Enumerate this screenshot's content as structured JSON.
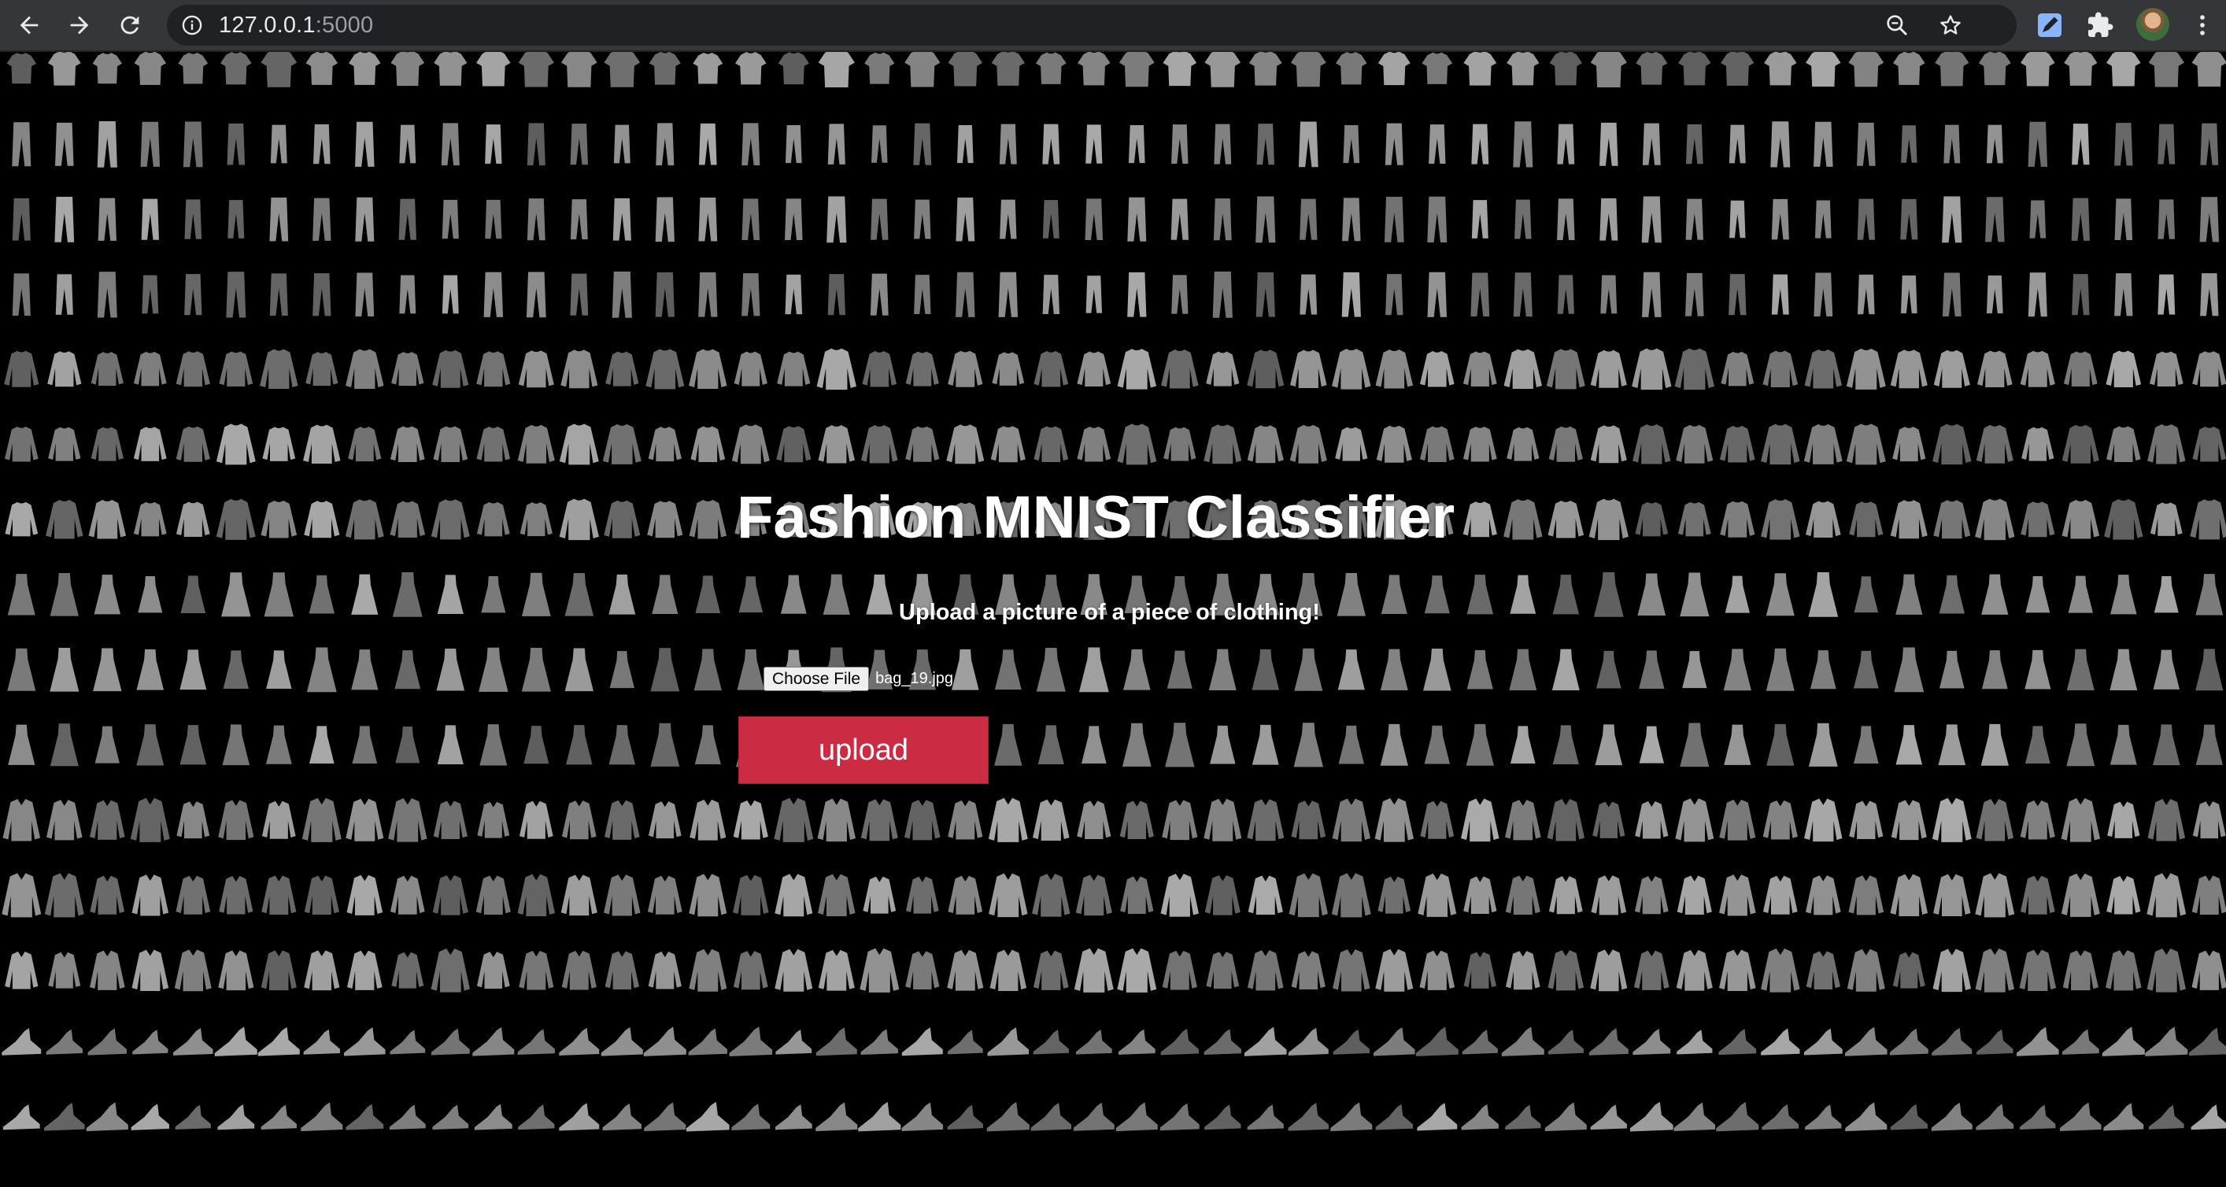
{
  "browser": {
    "url_host": "127.0.0.1",
    "url_port": ":5000",
    "nav": {
      "back_icon": "arrow-left-icon",
      "forward_icon": "arrow-right-icon",
      "reload_icon": "reload-icon"
    },
    "omnibox_icons": [
      "info-icon",
      "zoom-icon",
      "star-icon"
    ],
    "toolbar_icons": [
      "extension-pen-icon",
      "puzzle-icon",
      "avatar",
      "kebab-menu-icon"
    ]
  },
  "page": {
    "title": "Fashion MNIST Classifier",
    "subtitle": "Upload a picture of a piece of clothing!",
    "file_input": {
      "button_label": "Choose File",
      "file_name": "bag_19.jpg"
    },
    "upload_button": "upload",
    "colors": {
      "upload_button": "#cc2c43",
      "background": "#000000",
      "chrome": "#35363a",
      "omnibox": "#202124"
    },
    "background_image": "fashion-mnist-sample-grid",
    "background_row_kinds": [
      "top",
      "trouser",
      "trouser",
      "trouser",
      "pullover",
      "pullover",
      "pullover",
      "dress",
      "dress",
      "dress",
      "coat",
      "coat",
      "coat",
      "sandal",
      "sandal"
    ]
  }
}
